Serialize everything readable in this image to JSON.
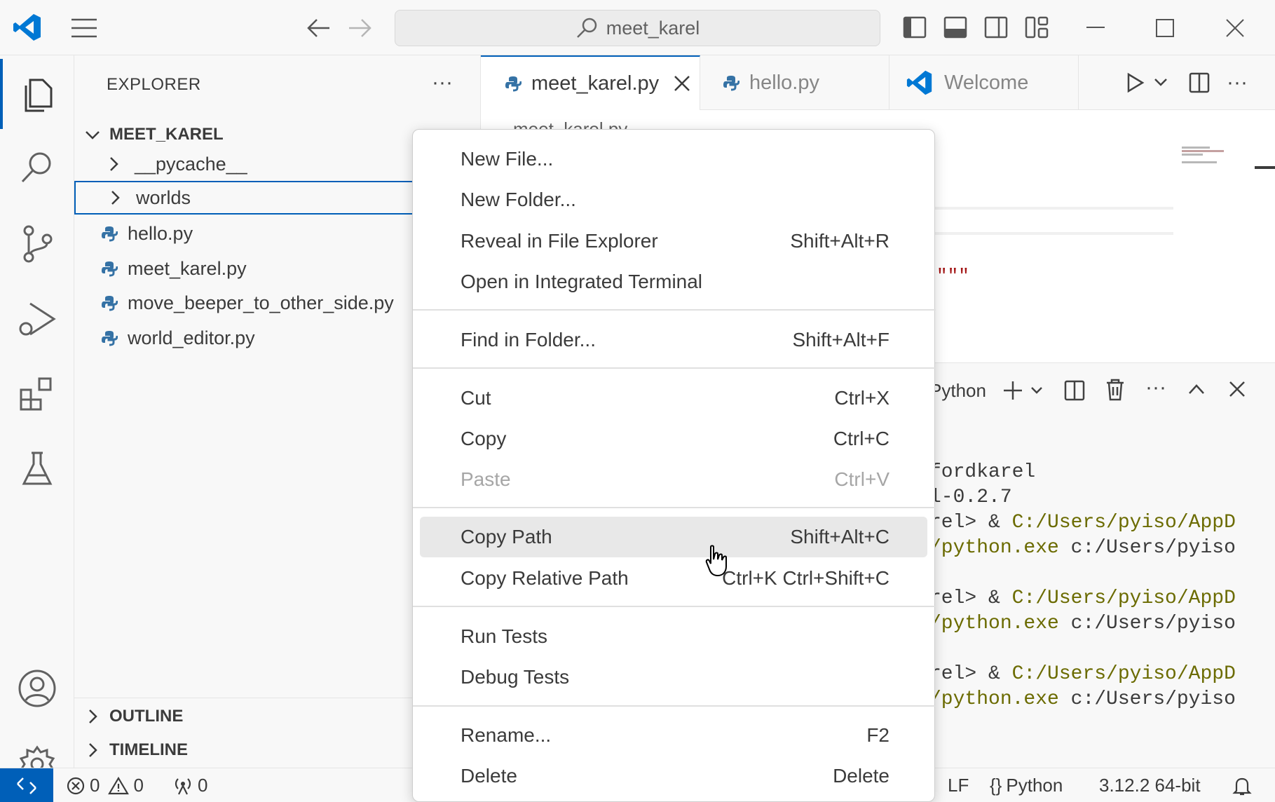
{
  "titlebar": {
    "search_text": "meet_karel"
  },
  "sidebar": {
    "title": "EXPLORER",
    "more": "···",
    "folder": "MEET_KAREL",
    "items": [
      {
        "label": "__pycache__",
        "type": "folder"
      },
      {
        "label": "worlds",
        "type": "folder"
      },
      {
        "label": "hello.py",
        "type": "file"
      },
      {
        "label": "meet_karel.py",
        "type": "file"
      },
      {
        "label": "move_beeper_to_other_side.py",
        "type": "file"
      },
      {
        "label": "world_editor.py",
        "type": "file"
      }
    ],
    "outline": "OUTLINE",
    "timeline": "TIMELINE"
  },
  "tabs": [
    {
      "label": "meet_karel.py",
      "active": true
    },
    {
      "label": "hello.py",
      "active": false
    },
    {
      "label": "Welcome",
      "active": false
    }
  ],
  "editor": {
    "breadcrumb": "meet_karel.py",
    "code_fragment": "\"\"\""
  },
  "panel": {
    "shell": "Python",
    "lines": [
      {
        "text": "fordkarel"
      },
      {
        "text": "l-0.2.7"
      },
      {
        "prefix": "rel> & ",
        "path": "C:/Users/pyiso/AppD"
      },
      {
        "path": "/python.exe",
        "suffix": " c:/Users/pyiso"
      },
      {
        "prefix": "rel> & ",
        "path": "C:/Users/pyiso/AppD"
      },
      {
        "path": "/python.exe",
        "suffix": " c:/Users/pyiso"
      },
      {
        "prefix": "rel> & ",
        "path": "C:/Users/pyiso/AppD"
      },
      {
        "path": "/python.exe",
        "suffix": " c:/Users/pyiso"
      }
    ]
  },
  "context_menu": {
    "groups": [
      [
        {
          "label": "New File...",
          "shortcut": ""
        },
        {
          "label": "New Folder...",
          "shortcut": ""
        },
        {
          "label": "Reveal in File Explorer",
          "shortcut": "Shift+Alt+R"
        },
        {
          "label": "Open in Integrated Terminal",
          "shortcut": ""
        }
      ],
      [
        {
          "label": "Find in Folder...",
          "shortcut": "Shift+Alt+F"
        }
      ],
      [
        {
          "label": "Cut",
          "shortcut": "Ctrl+X"
        },
        {
          "label": "Copy",
          "shortcut": "Ctrl+C"
        },
        {
          "label": "Paste",
          "shortcut": "Ctrl+V",
          "disabled": true
        }
      ],
      [
        {
          "label": "Copy Path",
          "shortcut": "Shift+Alt+C",
          "hover": true
        },
        {
          "label": "Copy Relative Path",
          "shortcut": "Ctrl+K Ctrl+Shift+C"
        }
      ],
      [
        {
          "label": "Run Tests",
          "shortcut": ""
        },
        {
          "label": "Debug Tests",
          "shortcut": ""
        }
      ],
      [
        {
          "label": "Rename...",
          "shortcut": "F2"
        },
        {
          "label": "Delete",
          "shortcut": "Delete"
        }
      ]
    ]
  },
  "statusbar": {
    "errors": "0",
    "warnings": "0",
    "ports": "0",
    "eol": "LF",
    "language": "Python",
    "interpreter": "3.12.2 64-bit"
  },
  "colors": {
    "accent": "#005fb8",
    "python_blue": "#3572a5",
    "terminal_path": "#6b6b00"
  }
}
